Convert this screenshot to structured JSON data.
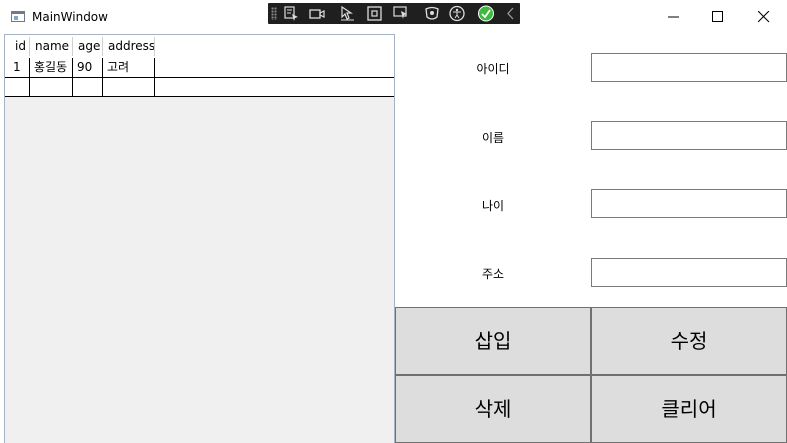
{
  "window": {
    "title": "MainWindow",
    "controls": [
      "minimize",
      "maximize",
      "close"
    ]
  },
  "debug_toolbar": {
    "icons": [
      "select-element-icon",
      "video-icon",
      "display-layout-adorners-icon",
      "track-focus-icon",
      "hot-reload-icon",
      "accessibility-icon",
      "checkmark-icon",
      "collapse-chevron-icon"
    ],
    "accent": "#3fb93f"
  },
  "grid": {
    "columns": [
      "id",
      "name",
      "age",
      "address"
    ],
    "rows": [
      [
        "1",
        "홍길동",
        "90",
        "고려"
      ]
    ]
  },
  "form": {
    "id_label": "아이디",
    "name_label": "이름",
    "age_label": "나이",
    "address_label": "주소",
    "id_value": "",
    "name_value": "",
    "age_value": "",
    "address_value": ""
  },
  "buttons": {
    "insert": "삽입",
    "update": "수정",
    "delete": "삭제",
    "clear": "클리어"
  }
}
